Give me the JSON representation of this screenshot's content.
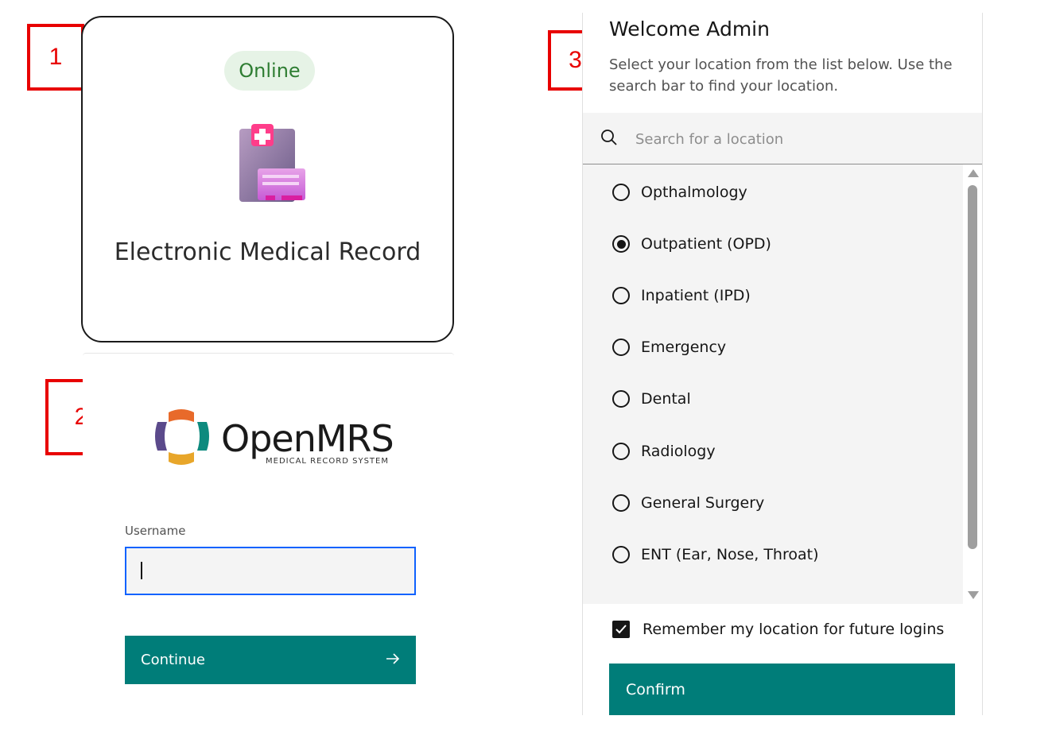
{
  "markers": {
    "panel1": "1",
    "panel2": "2",
    "panel3": "3"
  },
  "app_card": {
    "status": "Online",
    "icon": "medical-record-icon",
    "title": "Electronic Medical Record"
  },
  "login": {
    "logo_name": "OpenMRS",
    "logo_tagline": "MEDICAL RECORD SYSTEM",
    "username_label": "Username",
    "username_value": "",
    "continue_label": "Continue",
    "continue_icon": "arrow-right-icon"
  },
  "location": {
    "welcome": "Welcome Admin",
    "instructions": "Select your location from the list below. Use the search bar to find your location.",
    "search_placeholder": "Search for a location",
    "items": [
      {
        "label": "Opthalmology",
        "selected": false
      },
      {
        "label": "Outpatient (OPD)",
        "selected": true
      },
      {
        "label": "Inpatient (IPD)",
        "selected": false
      },
      {
        "label": "Emergency",
        "selected": false
      },
      {
        "label": "Dental",
        "selected": false
      },
      {
        "label": "Radiology",
        "selected": false
      },
      {
        "label": "General Surgery",
        "selected": false
      },
      {
        "label": "ENT (Ear, Nose, Throat)",
        "selected": false
      }
    ],
    "remember_label": "Remember my location for future logins",
    "remember_checked": true,
    "confirm_label": "Confirm"
  },
  "colors": {
    "primary": "#007d79",
    "focus": "#0f62fe",
    "online_bg": "#e6f3e6",
    "online_text": "#2e7d32",
    "marker": "#e80000"
  }
}
